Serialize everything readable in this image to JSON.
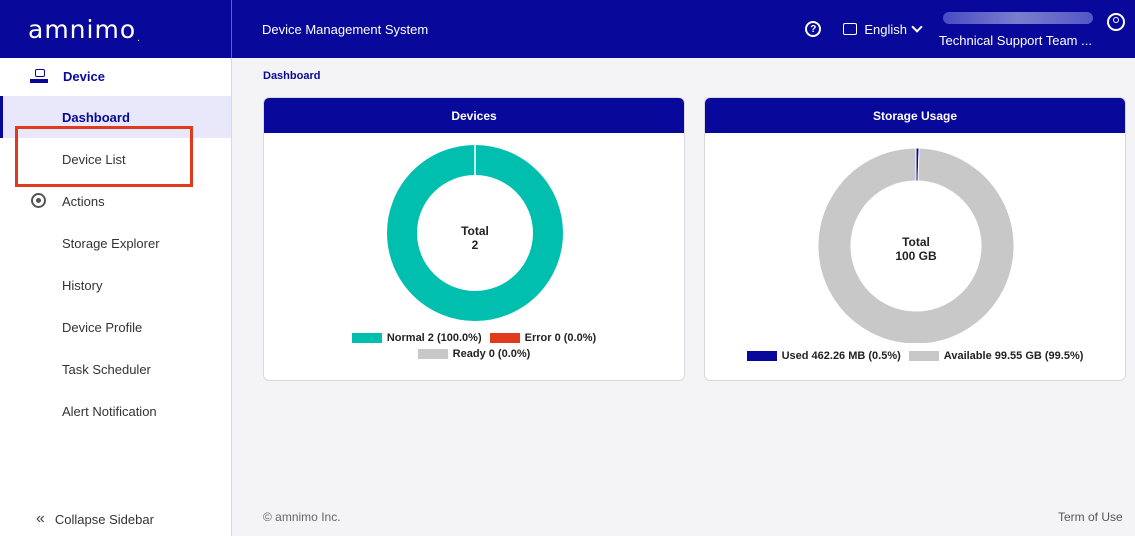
{
  "header": {
    "logo": "amnimo",
    "title": "Device Management System",
    "help_icon": "question-circle-icon",
    "language": "English",
    "team": "Technical Support Team ...",
    "user_icon": "user-circle-icon"
  },
  "sidebar": {
    "section_label": "Device",
    "items": [
      {
        "label": "Dashboard",
        "active": true
      },
      {
        "label": "Device List"
      },
      {
        "label": "Actions",
        "icon": "gear-circle-icon"
      },
      {
        "label": "Storage Explorer"
      },
      {
        "label": "History"
      },
      {
        "label": "Device Profile"
      },
      {
        "label": "Task Scheduler"
      },
      {
        "label": "Alert Notification"
      }
    ],
    "collapse_label": "Collapse Sidebar"
  },
  "breadcrumb": "Dashboard",
  "devices_card": {
    "title": "Devices",
    "center_title": "Total",
    "center_value": "2",
    "legend": {
      "normal": "Normal 2 (100.0%)",
      "error": "Error 0 (0.0%)",
      "ready": "Ready 0 (0.0%)"
    }
  },
  "storage_card": {
    "title": "Storage Usage",
    "center_title": "Total",
    "center_value": "100 GB",
    "legend": {
      "used": "Used 462.26 MB (0.5%)",
      "available": "Available 99.55 GB (99.5%)"
    }
  },
  "chart_data": [
    {
      "type": "pie",
      "title": "Devices",
      "categories": [
        "Normal",
        "Error",
        "Ready"
      ],
      "values": [
        2,
        0,
        0
      ],
      "colors": [
        "#00bfae",
        "#e03a1c",
        "#c8c8c8"
      ]
    },
    {
      "type": "pie",
      "title": "Storage Usage",
      "categories": [
        "Used",
        "Available"
      ],
      "values": [
        0.5,
        99.5
      ],
      "colors": [
        "#08089a",
        "#c8c8c8"
      ]
    }
  ],
  "footer": {
    "copyright": "© amnimo Inc.",
    "terms": "Term of Use"
  }
}
